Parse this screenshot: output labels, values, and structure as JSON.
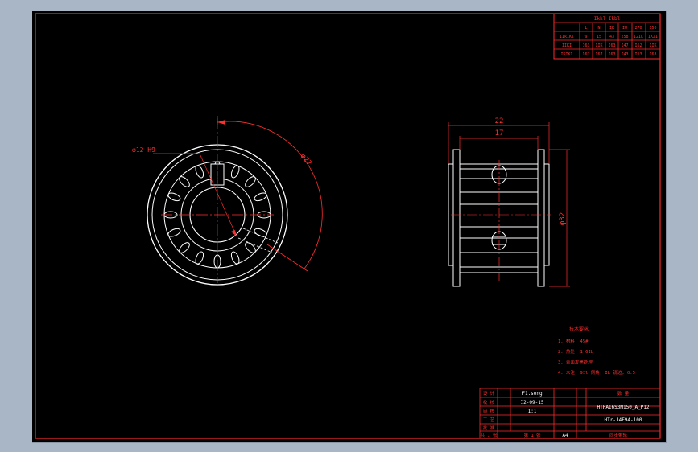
{
  "colors": {
    "background": "#a9b6c6",
    "canvas": "#000000",
    "frame": "#ff2a2a",
    "geometry": "#ffffff",
    "dimension": "#ff3030"
  },
  "table": {
    "title": "Ikkl Ikbl",
    "header": [
      "",
      "L",
      "N",
      "IK",
      "IU",
      "270",
      "I50"
    ],
    "rows": [
      [
        "IIkIKl",
        "9",
        "15",
        "43",
        "258",
        "I2IL",
        "IKZI"
      ],
      [
        "IIKI",
        "163",
        "IIK",
        "I63",
        "I47",
        "I62",
        "IIK"
      ],
      [
        "IKIKI",
        "I67",
        "I67",
        "I63",
        "I43",
        "I13",
        "I63"
      ]
    ]
  },
  "dims": {
    "bore": "φ12 H9",
    "pitch": "φ27",
    "overall_width": "22",
    "tooth_width": "17",
    "diameter": "φ32"
  },
  "notes": {
    "heading": "技术要求",
    "items": [
      "1. 材料: 45#",
      "2. 热处: 1.6Ib",
      "3. 表面发黑处理",
      "4. 未注: 9Il 倒角, IL 锐边, 0.5"
    ]
  },
  "title_block": {
    "left_labels": [
      "设 计",
      "校 核",
      "审 核",
      "工 艺",
      "批 准"
    ],
    "designer": "F1.song",
    "date": "I2-09-15",
    "scale": "1:1",
    "drawing_no": "HTPA16S3M150_A_P12",
    "part_no": "HTr-J4F94-100",
    "right_label": "数 量",
    "bottom_left": "共 1 张",
    "bottom_mid": "第 1 张",
    "size": "A4",
    "part_name": "同步带轮"
  }
}
